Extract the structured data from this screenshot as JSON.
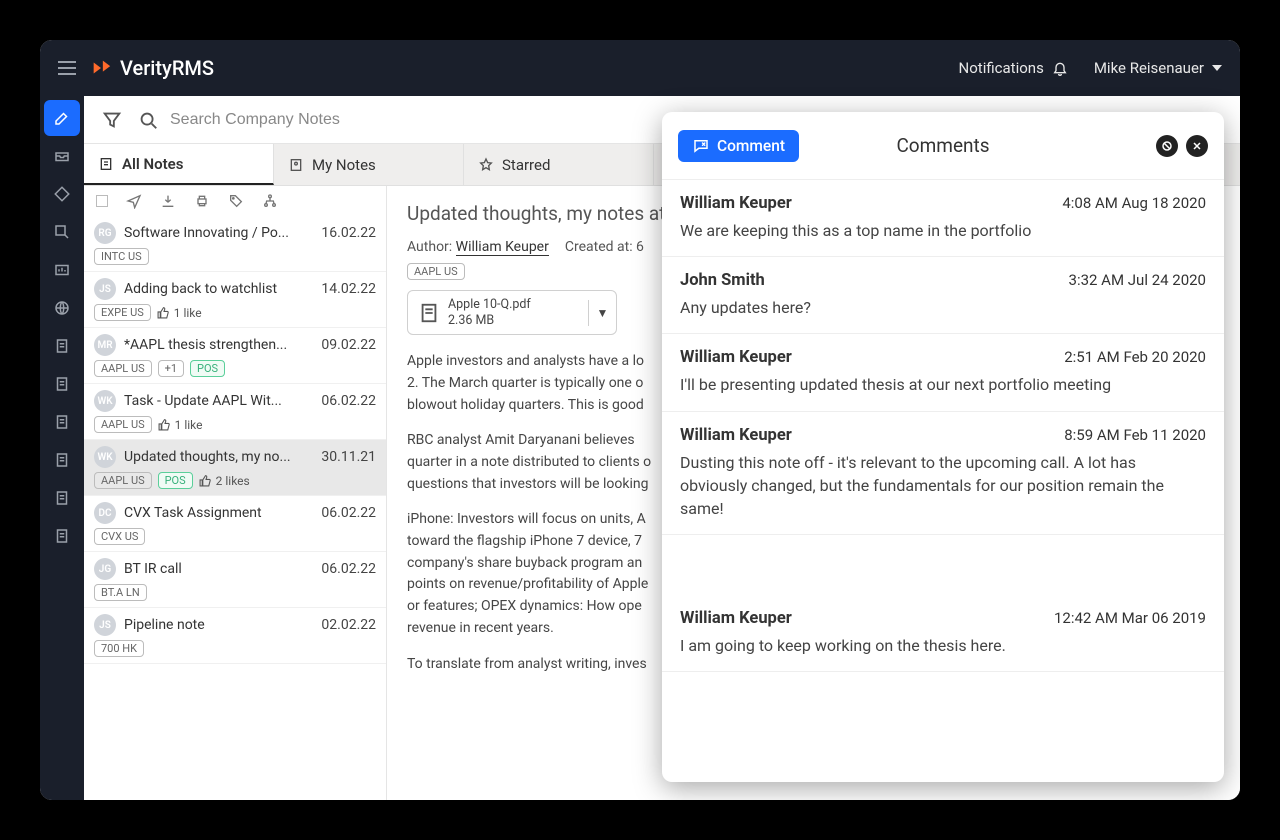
{
  "brand": "VerityRMS",
  "topbar": {
    "notifications": "Notifications",
    "user": "Mike Reisenauer"
  },
  "search": {
    "placeholder": "Search Company Notes"
  },
  "tabs": {
    "all": "All Notes",
    "my": "My Notes",
    "starred": "Starred"
  },
  "notes": [
    {
      "initials": "RG",
      "title": "Software Innovating / Po...",
      "date": "16.02.22",
      "ticker": "INTC US"
    },
    {
      "initials": "JS",
      "title": "Adding back to watchlist",
      "date": "14.02.22",
      "ticker": "EXPE US",
      "likes": "1 like"
    },
    {
      "initials": "MR",
      "title": "*AAPL thesis strengthen...",
      "date": "09.02.22",
      "ticker": "AAPL US",
      "extra": "+1",
      "pos": "POS"
    },
    {
      "initials": "WK",
      "title": "Task - Update AAPL Wit...",
      "date": "06.02.22",
      "ticker": "AAPL US",
      "likes": "1 like"
    },
    {
      "initials": "WK",
      "title": "Updated thoughts, my no...",
      "date": "30.11.21",
      "ticker": "AAPL US",
      "pos": "POS",
      "likes": "2 likes"
    },
    {
      "initials": "DC",
      "title": "CVX Task Assignment",
      "date": "06.02.22",
      "ticker": "CVX US"
    },
    {
      "initials": "JG",
      "title": "BT IR call",
      "date": "06.02.22",
      "ticker": "BT.A LN"
    },
    {
      "initials": "JS",
      "title": "Pipeline note",
      "date": "02.02.22",
      "ticker": "700 HK"
    }
  ],
  "detail": {
    "title": "Updated thoughts, my notes at",
    "author_label": "Author:",
    "author": "William Keuper",
    "created_label": "Created at: 6",
    "ticker": "AAPL US",
    "attachment_name": "Apple 10-Q.pdf",
    "attachment_size": "2.36 MB",
    "p1": "Apple investors and analysts have a lo",
    "p2": "2. The March quarter is typically one o",
    "p3": "blowout holiday quarters.  This is good",
    "p4": "RBC analyst Amit Daryanani believes",
    "p5": "quarter in a note distributed to clients o",
    "p6": "questions that investors will be looking",
    "p7": "iPhone: Investors will focus on units, A",
    "p8": "toward the flagship iPhone 7 device, 7",
    "p9": "company's share buyback program an",
    "p10": "points on revenue/profitability of Apple",
    "p11": "or features; OPEX dynamics: How ope",
    "p12": "revenue in recent years.",
    "p13": "To translate from analyst writing, inves"
  },
  "comments": {
    "button": "Comment",
    "title": "Comments",
    "items": [
      {
        "author": "William Keuper",
        "time": "4:08 AM Aug 18 2020",
        "body": "We are keeping this as a top name in the portfolio"
      },
      {
        "author": "John Smith",
        "time": "3:32 AM Jul 24 2020",
        "body": "Any updates here?"
      },
      {
        "author": "William Keuper",
        "time": "2:51 AM Feb 20 2020",
        "body": "I'll be presenting updated thesis at our next portfolio meeting"
      },
      {
        "author": "William Keuper",
        "time": "8:59 AM Feb 11 2020",
        "body": "Dusting this note off - it's relevant to the upcoming call. A lot has obviously changed, but the fundamentals for our position remain the same!"
      },
      {
        "author": "William Keuper",
        "time": "12:42 AM Mar 06 2019",
        "body": "I am going to keep working on the thesis here."
      }
    ]
  }
}
